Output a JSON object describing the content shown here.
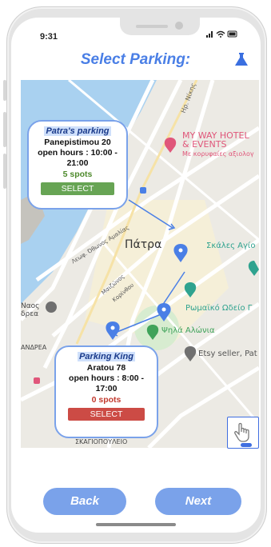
{
  "status": {
    "time": "9:31",
    "icons": "..ıl ≈ ▭"
  },
  "header": {
    "title": "Select Parking:",
    "icon": "flask-icon"
  },
  "map": {
    "city_label": "Πάτρα",
    "place_labels": {
      "hotel_line1": "MY WAY HOTEL",
      "hotel_line2": "& EVENTS",
      "hotel_sub": "Με κορυφαίες αξιολογ",
      "steps": "Σκάλες Αγίο",
      "odeon": "Ρωμαϊκό Ωδείο Γ",
      "psila": "Ψηλά Αλώνια",
      "etsy": "Etsy seller, Pat",
      "naos1": "Ναος",
      "naos2": "δρεα",
      "andrea": "ΑΝΔΡΕΑ",
      "skagiopouleio": "ΣΚΑΓΙΟΠΟΥΛΕΙΟ",
      "street_othonos": "Λεωφ. Όθωνος Αμαλίας",
      "street_maizonos": "Μαιζώνος",
      "street_korinthou": "Κορίνθου",
      "street_top": "Ηρ. Νίκης"
    },
    "colors": {
      "water": "#a9d1f0",
      "land": "#eceae4",
      "park": "#d7ecd0",
      "road": "#ffffff",
      "accent": "#4a7fe6"
    }
  },
  "parkings": [
    {
      "name": "Patra's parking",
      "address": "Panepistimou 20",
      "hours_line1": "open hours : 10:00 -",
      "hours_line2": "21:00",
      "spots": "5 spots",
      "select_label": "SELECT",
      "status_color": "#67a454"
    },
    {
      "name": "Parking King",
      "address": "Aratou 78",
      "hours_line1": "open hours : 8:00 -",
      "hours_line2": "17:00",
      "spots": "0 spots",
      "select_label": "SELECT",
      "status_color": "#cc4b45"
    }
  ],
  "controls": {
    "gesture_icon": "hand-pointer-icon"
  },
  "footer": {
    "back_label": "Back",
    "next_label": "Next"
  }
}
